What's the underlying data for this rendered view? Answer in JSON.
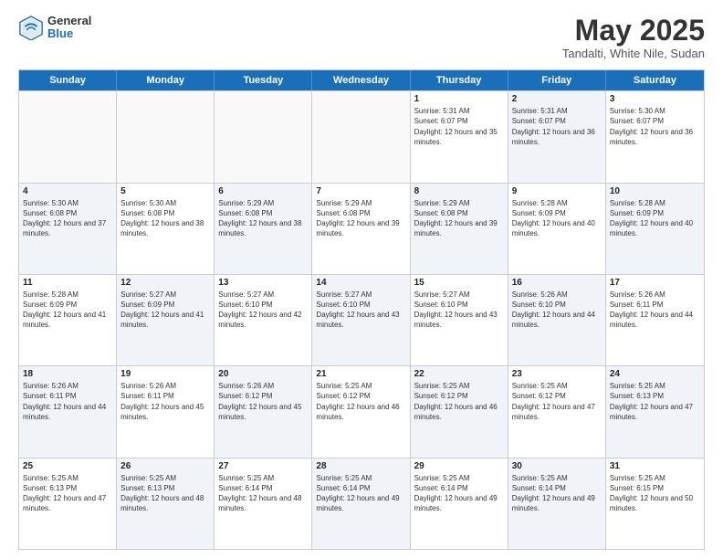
{
  "header": {
    "logo": {
      "general": "General",
      "blue": "Blue"
    },
    "title": "May 2025",
    "location": "Tandalti, White Nile, Sudan"
  },
  "days": [
    "Sunday",
    "Monday",
    "Tuesday",
    "Wednesday",
    "Thursday",
    "Friday",
    "Saturday"
  ],
  "rows": [
    [
      {
        "num": "",
        "sunrise": "",
        "sunset": "",
        "daylight": "",
        "empty": true
      },
      {
        "num": "",
        "sunrise": "",
        "sunset": "",
        "daylight": "",
        "empty": true
      },
      {
        "num": "",
        "sunrise": "",
        "sunset": "",
        "daylight": "",
        "empty": true
      },
      {
        "num": "",
        "sunrise": "",
        "sunset": "",
        "daylight": "",
        "empty": true
      },
      {
        "num": "1",
        "sunrise": "Sunrise: 5:31 AM",
        "sunset": "Sunset: 6:07 PM",
        "daylight": "Daylight: 12 hours and 35 minutes.",
        "empty": false,
        "alt": false
      },
      {
        "num": "2",
        "sunrise": "Sunrise: 5:31 AM",
        "sunset": "Sunset: 6:07 PM",
        "daylight": "Daylight: 12 hours and 36 minutes.",
        "empty": false,
        "alt": true
      },
      {
        "num": "3",
        "sunrise": "Sunrise: 5:30 AM",
        "sunset": "Sunset: 6:07 PM",
        "daylight": "Daylight: 12 hours and 36 minutes.",
        "empty": false,
        "alt": false
      }
    ],
    [
      {
        "num": "4",
        "sunrise": "Sunrise: 5:30 AM",
        "sunset": "Sunset: 6:08 PM",
        "daylight": "Daylight: 12 hours and 37 minutes.",
        "empty": false,
        "alt": true
      },
      {
        "num": "5",
        "sunrise": "Sunrise: 5:30 AM",
        "sunset": "Sunset: 6:08 PM",
        "daylight": "Daylight: 12 hours and 38 minutes.",
        "empty": false,
        "alt": false
      },
      {
        "num": "6",
        "sunrise": "Sunrise: 5:29 AM",
        "sunset": "Sunset: 6:08 PM",
        "daylight": "Daylight: 12 hours and 38 minutes.",
        "empty": false,
        "alt": true
      },
      {
        "num": "7",
        "sunrise": "Sunrise: 5:29 AM",
        "sunset": "Sunset: 6:08 PM",
        "daylight": "Daylight: 12 hours and 39 minutes.",
        "empty": false,
        "alt": false
      },
      {
        "num": "8",
        "sunrise": "Sunrise: 5:29 AM",
        "sunset": "Sunset: 6:08 PM",
        "daylight": "Daylight: 12 hours and 39 minutes.",
        "empty": false,
        "alt": true
      },
      {
        "num": "9",
        "sunrise": "Sunrise: 5:28 AM",
        "sunset": "Sunset: 6:09 PM",
        "daylight": "Daylight: 12 hours and 40 minutes.",
        "empty": false,
        "alt": false
      },
      {
        "num": "10",
        "sunrise": "Sunrise: 5:28 AM",
        "sunset": "Sunset: 6:09 PM",
        "daylight": "Daylight: 12 hours and 40 minutes.",
        "empty": false,
        "alt": true
      }
    ],
    [
      {
        "num": "11",
        "sunrise": "Sunrise: 5:28 AM",
        "sunset": "Sunset: 6:09 PM",
        "daylight": "Daylight: 12 hours and 41 minutes.",
        "empty": false,
        "alt": false
      },
      {
        "num": "12",
        "sunrise": "Sunrise: 5:27 AM",
        "sunset": "Sunset: 6:09 PM",
        "daylight": "Daylight: 12 hours and 41 minutes.",
        "empty": false,
        "alt": true
      },
      {
        "num": "13",
        "sunrise": "Sunrise: 5:27 AM",
        "sunset": "Sunset: 6:10 PM",
        "daylight": "Daylight: 12 hours and 42 minutes.",
        "empty": false,
        "alt": false
      },
      {
        "num": "14",
        "sunrise": "Sunrise: 5:27 AM",
        "sunset": "Sunset: 6:10 PM",
        "daylight": "Daylight: 12 hours and 43 minutes.",
        "empty": false,
        "alt": true
      },
      {
        "num": "15",
        "sunrise": "Sunrise: 5:27 AM",
        "sunset": "Sunset: 6:10 PM",
        "daylight": "Daylight: 12 hours and 43 minutes.",
        "empty": false,
        "alt": false
      },
      {
        "num": "16",
        "sunrise": "Sunrise: 5:26 AM",
        "sunset": "Sunset: 6:10 PM",
        "daylight": "Daylight: 12 hours and 44 minutes.",
        "empty": false,
        "alt": true
      },
      {
        "num": "17",
        "sunrise": "Sunrise: 5:26 AM",
        "sunset": "Sunset: 6:11 PM",
        "daylight": "Daylight: 12 hours and 44 minutes.",
        "empty": false,
        "alt": false
      }
    ],
    [
      {
        "num": "18",
        "sunrise": "Sunrise: 5:26 AM",
        "sunset": "Sunset: 6:11 PM",
        "daylight": "Daylight: 12 hours and 44 minutes.",
        "empty": false,
        "alt": true
      },
      {
        "num": "19",
        "sunrise": "Sunrise: 5:26 AM",
        "sunset": "Sunset: 6:11 PM",
        "daylight": "Daylight: 12 hours and 45 minutes.",
        "empty": false,
        "alt": false
      },
      {
        "num": "20",
        "sunrise": "Sunrise: 5:26 AM",
        "sunset": "Sunset: 6:12 PM",
        "daylight": "Daylight: 12 hours and 45 minutes.",
        "empty": false,
        "alt": true
      },
      {
        "num": "21",
        "sunrise": "Sunrise: 5:25 AM",
        "sunset": "Sunset: 6:12 PM",
        "daylight": "Daylight: 12 hours and 46 minutes.",
        "empty": false,
        "alt": false
      },
      {
        "num": "22",
        "sunrise": "Sunrise: 5:25 AM",
        "sunset": "Sunset: 6:12 PM",
        "daylight": "Daylight: 12 hours and 46 minutes.",
        "empty": false,
        "alt": true
      },
      {
        "num": "23",
        "sunrise": "Sunrise: 5:25 AM",
        "sunset": "Sunset: 6:12 PM",
        "daylight": "Daylight: 12 hours and 47 minutes.",
        "empty": false,
        "alt": false
      },
      {
        "num": "24",
        "sunrise": "Sunrise: 5:25 AM",
        "sunset": "Sunset: 6:13 PM",
        "daylight": "Daylight: 12 hours and 47 minutes.",
        "empty": false,
        "alt": true
      }
    ],
    [
      {
        "num": "25",
        "sunrise": "Sunrise: 5:25 AM",
        "sunset": "Sunset: 6:13 PM",
        "daylight": "Daylight: 12 hours and 47 minutes.",
        "empty": false,
        "alt": false
      },
      {
        "num": "26",
        "sunrise": "Sunrise: 5:25 AM",
        "sunset": "Sunset: 6:13 PM",
        "daylight": "Daylight: 12 hours and 48 minutes.",
        "empty": false,
        "alt": true
      },
      {
        "num": "27",
        "sunrise": "Sunrise: 5:25 AM",
        "sunset": "Sunset: 6:14 PM",
        "daylight": "Daylight: 12 hours and 48 minutes.",
        "empty": false,
        "alt": false
      },
      {
        "num": "28",
        "sunrise": "Sunrise: 5:25 AM",
        "sunset": "Sunset: 6:14 PM",
        "daylight": "Daylight: 12 hours and 49 minutes.",
        "empty": false,
        "alt": true
      },
      {
        "num": "29",
        "sunrise": "Sunrise: 5:25 AM",
        "sunset": "Sunset: 6:14 PM",
        "daylight": "Daylight: 12 hours and 49 minutes.",
        "empty": false,
        "alt": false
      },
      {
        "num": "30",
        "sunrise": "Sunrise: 5:25 AM",
        "sunset": "Sunset: 6:14 PM",
        "daylight": "Daylight: 12 hours and 49 minutes.",
        "empty": false,
        "alt": true
      },
      {
        "num": "31",
        "sunrise": "Sunrise: 5:25 AM",
        "sunset": "Sunset: 6:15 PM",
        "daylight": "Daylight: 12 hours and 50 minutes.",
        "empty": false,
        "alt": false
      }
    ]
  ]
}
